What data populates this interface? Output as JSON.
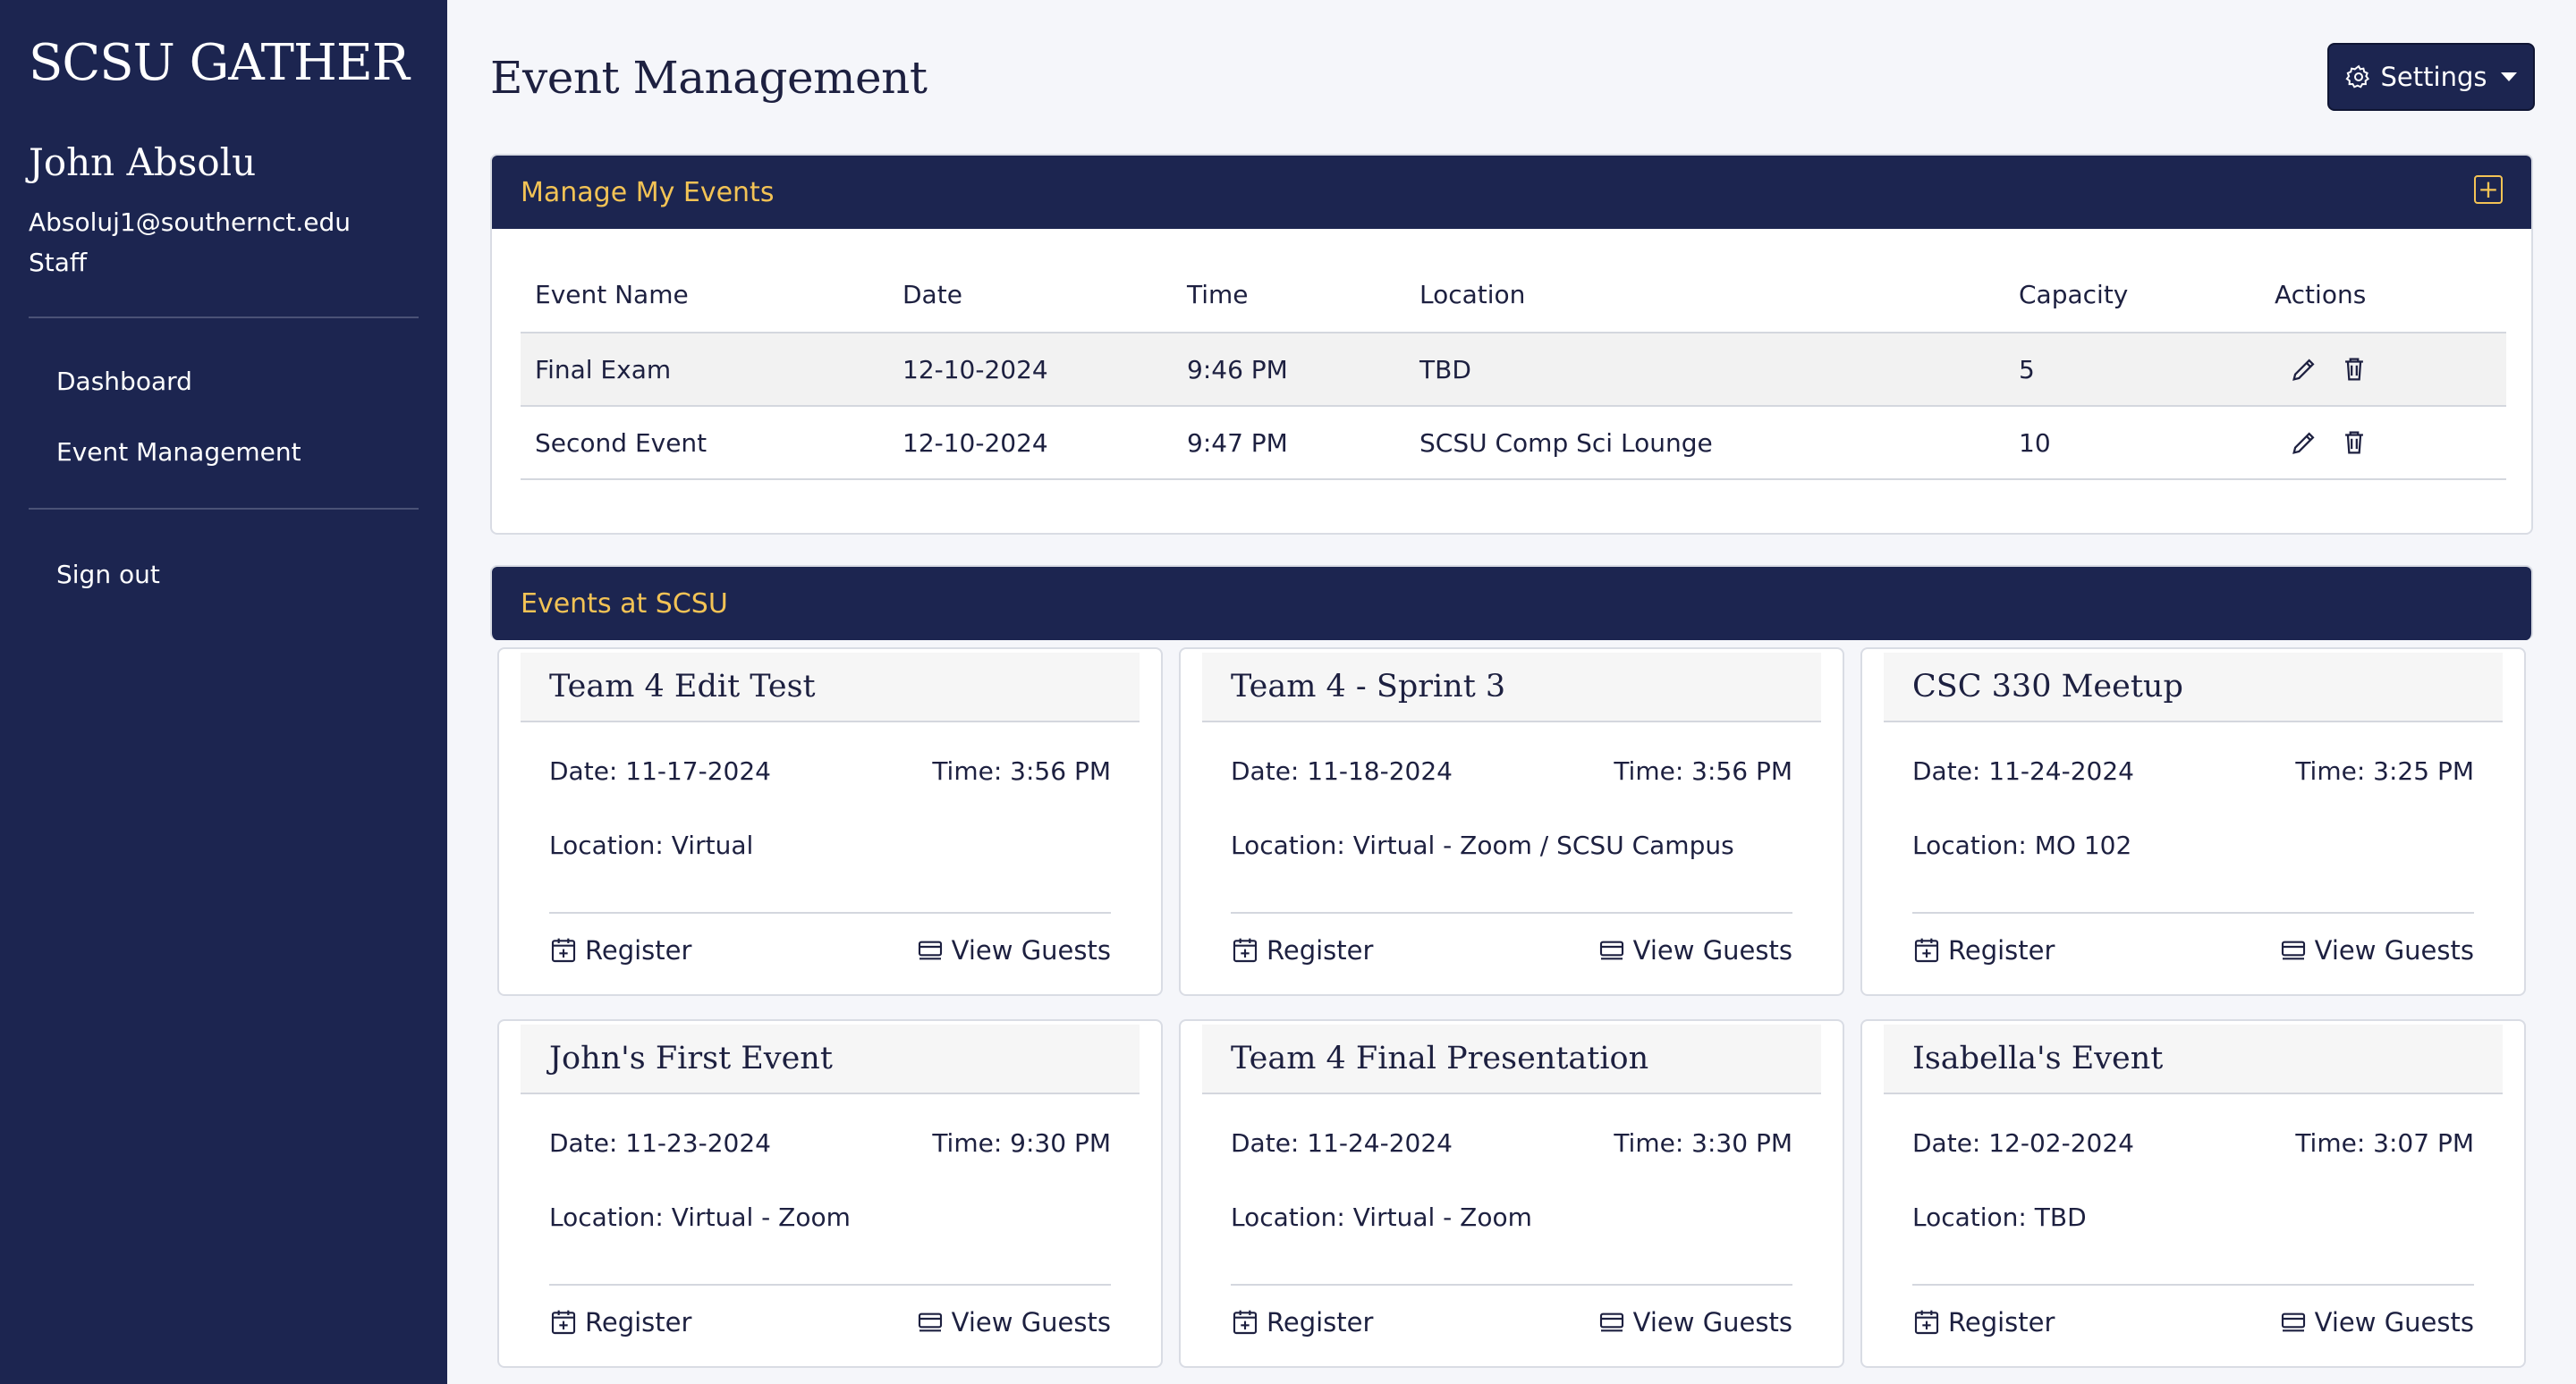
{
  "sidebar": {
    "brand": "SCSU GATHER",
    "user_name": "John Absolu",
    "email": "Absoluj1@southernct.edu",
    "role": "Staff",
    "nav": [
      "Dashboard",
      "Event Management"
    ],
    "signout": "Sign out"
  },
  "header": {
    "title": "Event Management",
    "settings_label": "Settings"
  },
  "manage": {
    "title": "Manage My Events",
    "columns": [
      "Event Name",
      "Date",
      "Time",
      "Location",
      "Capacity",
      "Actions"
    ],
    "rows": [
      [
        "Final Exam",
        "12-10-2024",
        "9:46 PM",
        "TBD",
        "5"
      ],
      [
        "Second Event",
        "12-10-2024",
        "9:47 PM",
        "SCSU Comp Sci Lounge",
        "10"
      ]
    ]
  },
  "events": {
    "title": "Events at SCSU",
    "register_label": "Register",
    "guests_label": "View Guests",
    "cards": [
      {
        "title": "Team 4 Edit Test",
        "date": "Date: 11-17-2024",
        "time": "Time: 3:56 PM",
        "location": "Location: Virtual"
      },
      {
        "title": "Team 4 - Sprint 3",
        "date": "Date: 11-18-2024",
        "time": "Time: 3:56 PM",
        "location": "Location: Virtual - Zoom / SCSU Campus"
      },
      {
        "title": "CSC 330 Meetup",
        "date": "Date: 11-24-2024",
        "time": "Time: 3:25 PM",
        "location": "Location: MO 102"
      },
      {
        "title": "John's First Event",
        "date": "Date: 11-23-2024",
        "time": "Time: 9:30 PM",
        "location": "Location: Virtual - Zoom"
      },
      {
        "title": "Team 4 Final Presentation",
        "date": "Date: 11-24-2024",
        "time": "Time: 3:30 PM",
        "location": "Location: Virtual - Zoom"
      },
      {
        "title": "Isabella's Event",
        "date": "Date: 12-02-2024",
        "time": "Time: 3:07 PM",
        "location": "Location: TBD"
      }
    ]
  },
  "colors": {
    "navy": "#1c2550",
    "gold": "#f3c355"
  }
}
